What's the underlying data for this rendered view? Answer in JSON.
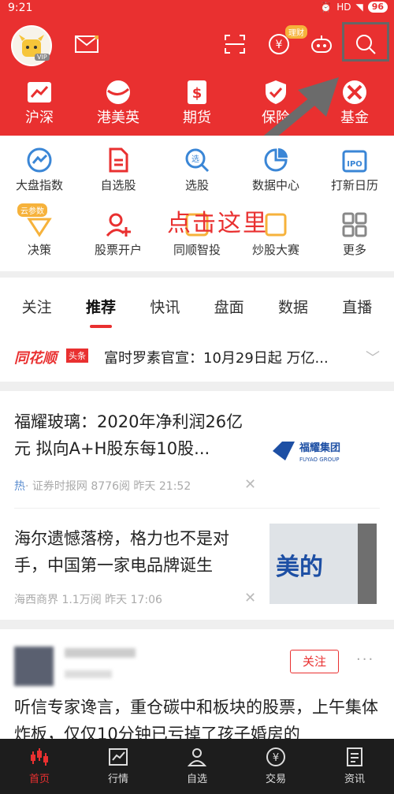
{
  "status": {
    "time": "9:21",
    "hd": "HD",
    "battery": "96"
  },
  "header": {
    "licai_badge": "理财",
    "avatar_badge": "VIP"
  },
  "quicknav": [
    {
      "label": "沪深",
      "icon": "chart-icon"
    },
    {
      "label": "港美英",
      "icon": "globe-icon"
    },
    {
      "label": "期货",
      "icon": "futures-icon"
    },
    {
      "label": "保险",
      "icon": "shield-icon"
    },
    {
      "label": "基金",
      "icon": "fund-icon"
    }
  ],
  "grid": {
    "row1": [
      "大盘指数",
      "自选股",
      "选股",
      "数据中心",
      "打新日历"
    ],
    "row2": [
      "决策",
      "股票开户",
      "同顺智投",
      "炒股大赛",
      "更多"
    ],
    "yun_badge": "云参数",
    "overlay": "点击这里"
  },
  "tabs": [
    "关注",
    "推荐",
    "快讯",
    "盘面",
    "数据",
    "直播"
  ],
  "headline": {
    "brand": "同花顺",
    "tag": "头条",
    "text": "富时罗素官宣：10月29日起 万亿..."
  },
  "news": [
    {
      "title": "福耀玻璃：2020年净利润26亿元 拟向A+H股东每10股...",
      "hot": "热",
      "meta": "· 证券时报网   8776阅  昨天 21:52",
      "thumb": "福耀集团",
      "thumb_sub": "FUYAO GROUP"
    },
    {
      "title": "海尔遗憾落榜，格力也不是对手，中国第一家电品牌诞生",
      "meta": "海西商界   1.1万阅  昨天 17:06",
      "thumb": "美的"
    }
  ],
  "post": {
    "follow": "关注",
    "text": "听信专家谗言，重仓碳中和板块的股票，上午集体炸板，仅仅10分钟已亏掉了孩子婚房的"
  },
  "tabbar": [
    "首页",
    "行情",
    "自选",
    "交易",
    "资讯"
  ],
  "colors": {
    "brand_red": "#e93030",
    "tabbar_bg": "#1d1d1d"
  }
}
